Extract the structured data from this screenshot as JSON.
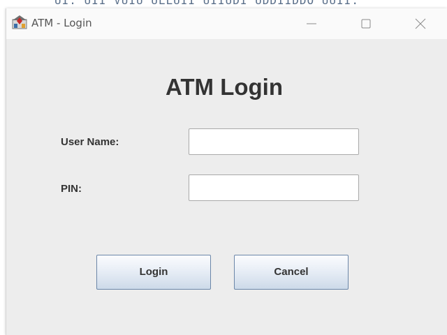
{
  "background_window": {
    "partial_text": "UI. UII  VUIU ULLUII UIIUDI UDDIIDDO UUII."
  },
  "window": {
    "title": "ATM - Login",
    "controls": [
      "minimize-icon",
      "maximize-icon",
      "close-icon"
    ]
  },
  "form": {
    "heading": "ATM Login",
    "username_label": "User Name:",
    "username_value": "",
    "pin_label": "PIN:",
    "pin_value": "",
    "login_label": "Login",
    "cancel_label": "Cancel"
  },
  "colors": {
    "window_background": "#ededed",
    "titlebar_background": "#fafafa",
    "text": "#333333",
    "button_border": "#6b86a8"
  }
}
